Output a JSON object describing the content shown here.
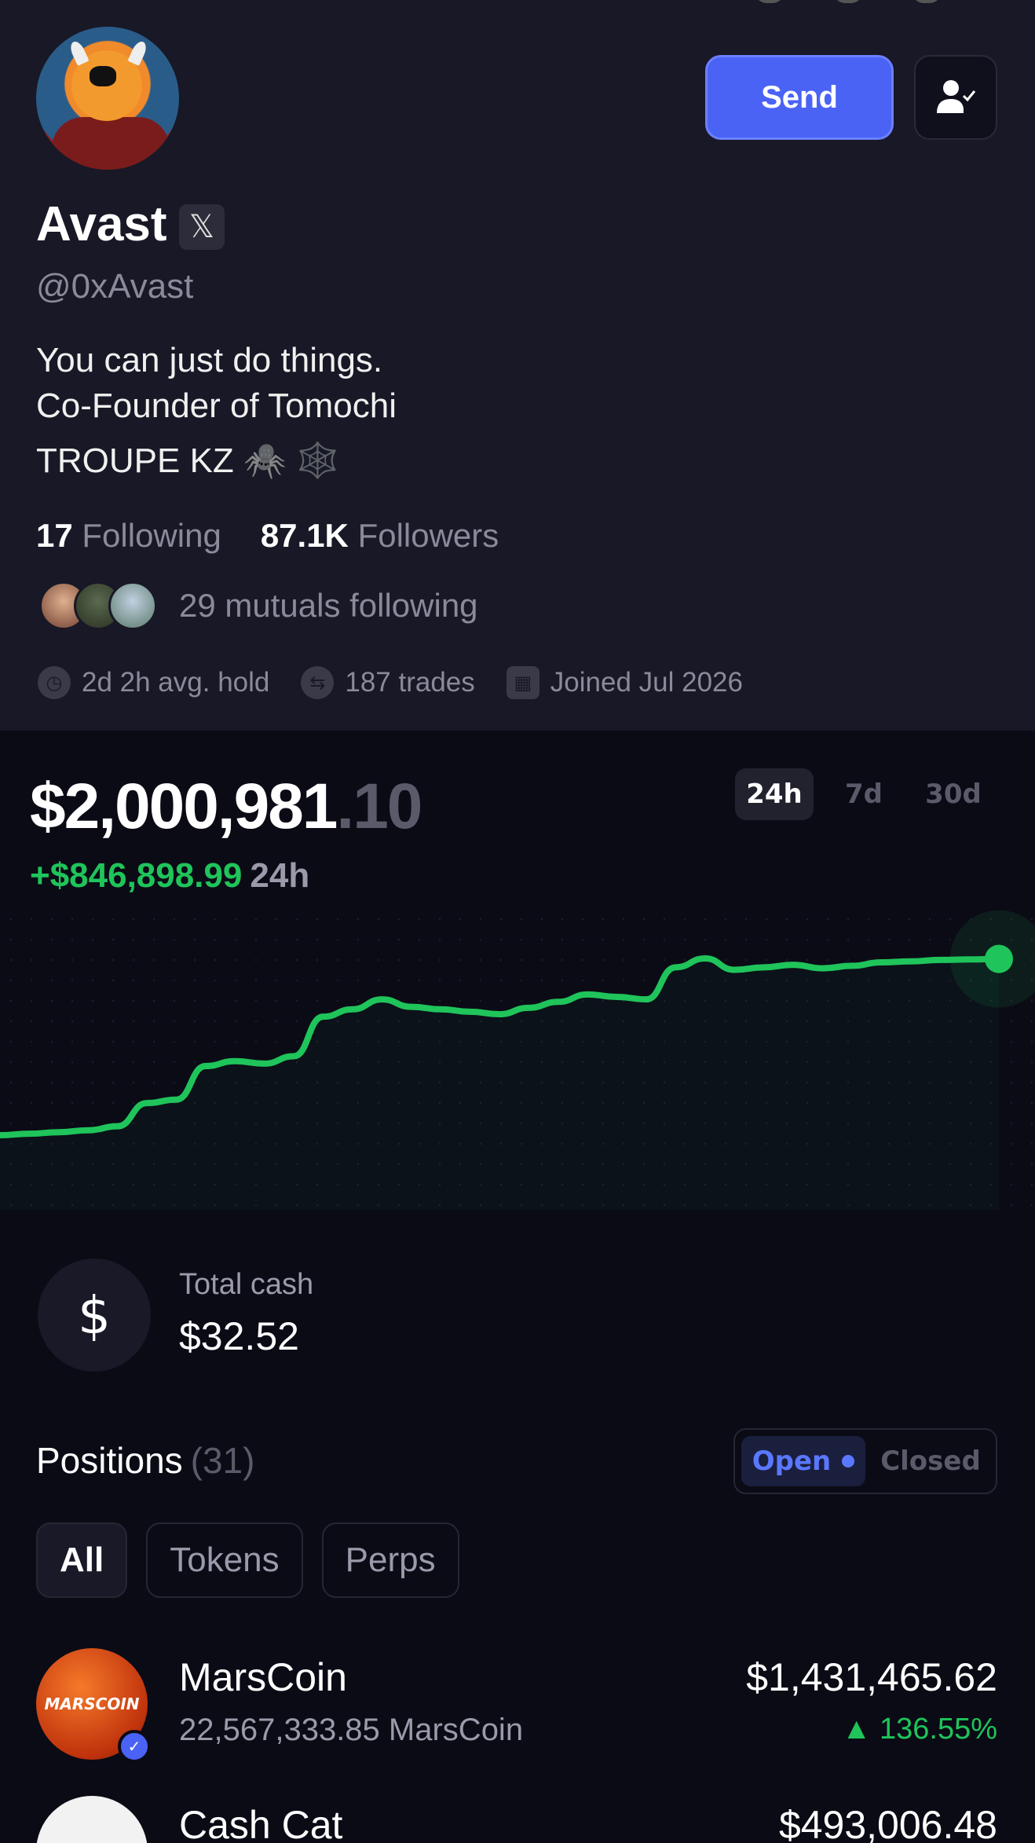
{
  "profile": {
    "name": "Avast",
    "handle": "@0xAvast",
    "bio": [
      "You can just do things.",
      "Co-Founder of Tomochi",
      "TROUPE KZ 🕷️ 🕸️"
    ],
    "following_count": "17",
    "following_label": "Following",
    "followers_count": "87.1K",
    "followers_label": "Followers",
    "mutuals_text": "29 mutuals following",
    "avg_hold": "2d 2h avg. hold",
    "trades": "187 trades",
    "joined": "Joined Jul 2026",
    "x_badge": "𝕏"
  },
  "actions": {
    "send_label": "Send"
  },
  "portfolio": {
    "balance_main": "$2,000,981",
    "balance_cents": ".10",
    "change_value": "+$846,898.99",
    "change_period": "24h",
    "ranges": [
      "24h",
      "7d",
      "30d"
    ],
    "active_range": "24h",
    "accent_color": "#1fc45a"
  },
  "chart_data": {
    "type": "line",
    "x": [
      0,
      1,
      2,
      3,
      4,
      5,
      6,
      7,
      8,
      9,
      10,
      11,
      12,
      13,
      14,
      15,
      16,
      17,
      18,
      19,
      20,
      21,
      22,
      23,
      24,
      25,
      26,
      27,
      28,
      29,
      30,
      31,
      32,
      33,
      34
    ],
    "values": [
      0,
      0.3,
      0.6,
      1.0,
      1.8,
      6.5,
      7.2,
      14,
      15,
      14.5,
      16,
      24,
      25.5,
      27.5,
      26,
      25.5,
      25,
      24.5,
      25.8,
      27,
      28.5,
      28,
      27.5,
      34,
      35.8,
      33.5,
      34,
      34.5,
      33.8,
      34.3,
      35,
      35.2,
      35.5,
      35.6,
      35.7
    ],
    "series_color": "#1fc45a",
    "grid": "dotted",
    "xlabel": "",
    "ylabel": ""
  },
  "cash": {
    "icon_glyph": "$",
    "label": "Total cash",
    "value": "$32.52"
  },
  "positions": {
    "title": "Positions",
    "count": "(31)",
    "toggle_open": "Open",
    "toggle_closed": "Closed",
    "filters": [
      "All",
      "Tokens",
      "Perps"
    ],
    "items": [
      {
        "name": "MarsCoin",
        "logo_text": "MARSCOIN",
        "amount": "22,567,333.85 MarsCoin",
        "value": "$1,431,465.62",
        "change": "▲ 136.55%"
      },
      {
        "name": "Cash Cat",
        "value": "$493,006.48"
      }
    ]
  }
}
